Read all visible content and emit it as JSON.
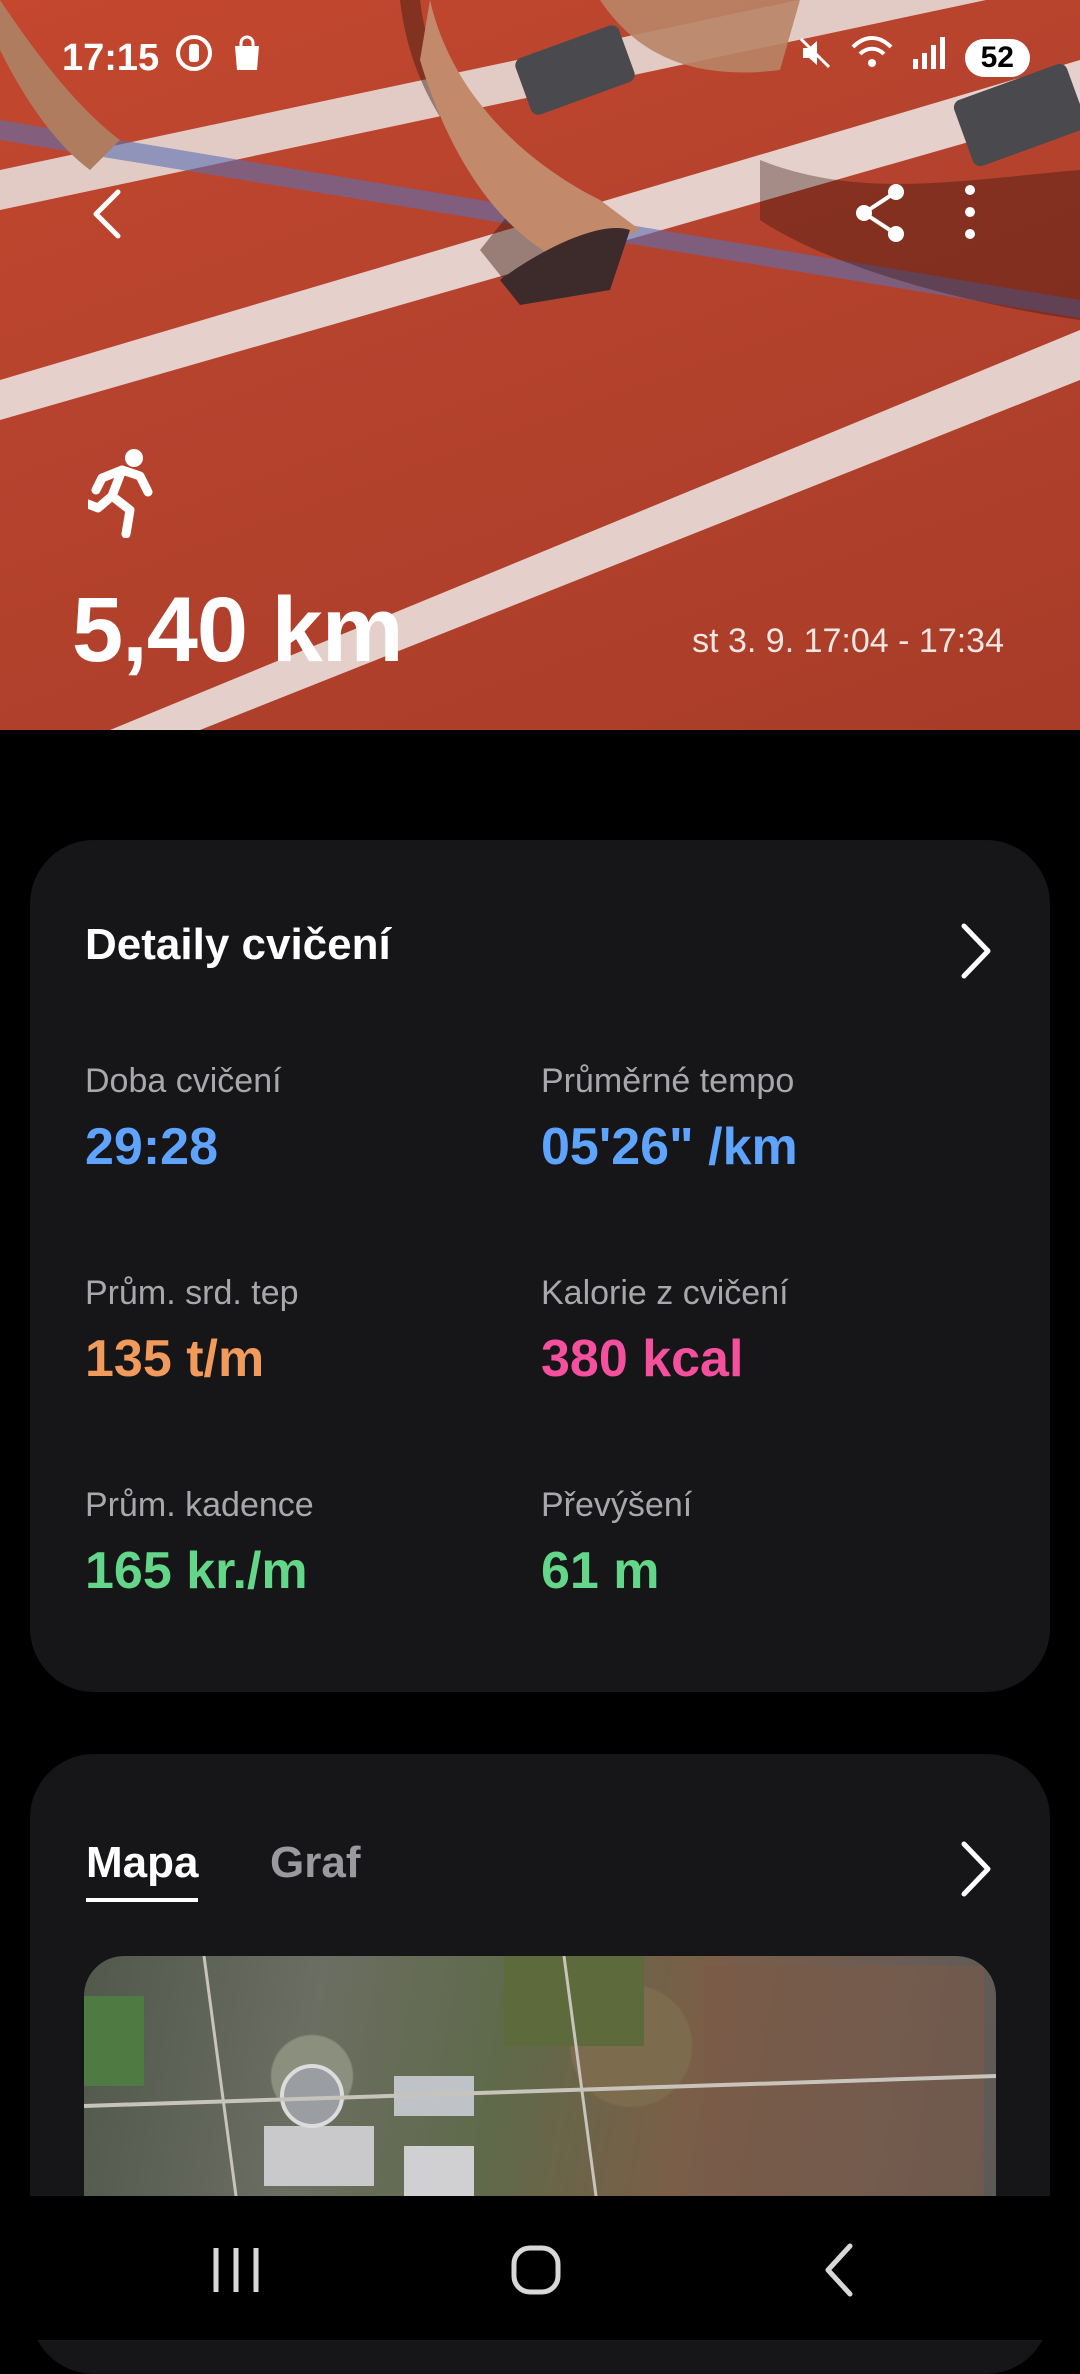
{
  "status_bar": {
    "time": "17:15",
    "battery": "52"
  },
  "hero": {
    "distance": "5,40 km",
    "date_range": "st 3. 9. 17:04 - 17:34"
  },
  "details": {
    "title": "Detaily cvičení",
    "stats": [
      {
        "label": "Doba cvičení",
        "value": "29:28",
        "color": "#5ea4ff"
      },
      {
        "label": "Průměrné tempo",
        "value": "05'26\" /km",
        "color": "#5ea4ff"
      },
      {
        "label": "Prům. srd. tep",
        "value": "135 t/m",
        "color": "#f09a5c"
      },
      {
        "label": "Kalorie z cvičení",
        "value": "380 kcal",
        "color": "#f5509e"
      },
      {
        "label": "Prům. kadence",
        "value": "165 kr./m",
        "color": "#63d68a"
      },
      {
        "label": "Převýšení",
        "value": "61 m",
        "color": "#63d68a"
      }
    ]
  },
  "map_card": {
    "tabs": [
      {
        "label": "Mapa",
        "active": true
      },
      {
        "label": "Graf",
        "active": false
      }
    ]
  },
  "icons": [
    "back-icon",
    "share-icon",
    "more-icon",
    "running-icon",
    "chevron-right-icon",
    "recent-apps-icon",
    "home-icon",
    "nav-back-icon"
  ]
}
